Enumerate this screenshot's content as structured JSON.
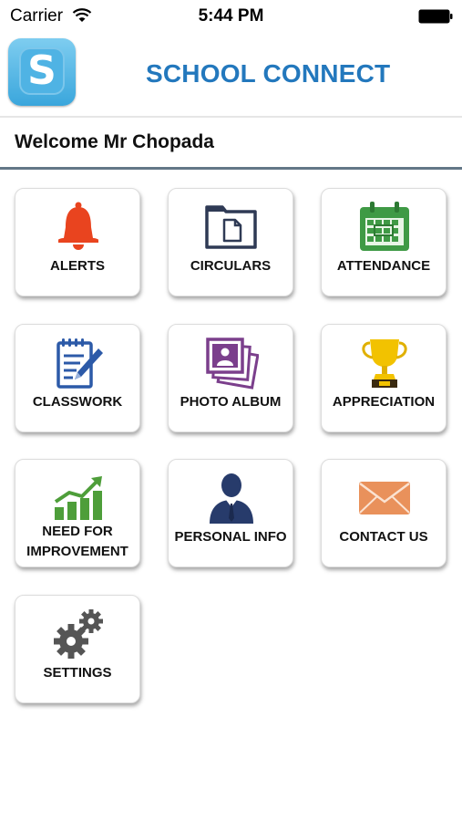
{
  "status_bar": {
    "carrier": "Carrier",
    "time": "5:44 PM"
  },
  "header": {
    "logo_letter": "S",
    "title": "SCHOOL CONNECT"
  },
  "welcome": {
    "text": "Welcome Mr Chopada"
  },
  "menu": {
    "alerts": {
      "label": "ALERTS",
      "icon": "bell-icon"
    },
    "circulars": {
      "label": "CIRCULARS",
      "icon": "folder-document-icon"
    },
    "attendance": {
      "label": "ATTENDANCE",
      "icon": "calendar-icon"
    },
    "classwork": {
      "label": "CLASSWORK",
      "icon": "notepad-pencil-icon"
    },
    "photo_album": {
      "label": "PHOTO ALBUM",
      "icon": "photo-stack-icon"
    },
    "appreciation": {
      "label": "APPRECIATION",
      "icon": "trophy-icon"
    },
    "need_for_improvement": {
      "label_line1": "NEED FOR",
      "label_line2": "IMPROVEMENT",
      "icon": "growth-chart-icon"
    },
    "personal_info": {
      "label": "PERSONAL INFO",
      "icon": "person-icon"
    },
    "contact_us": {
      "label": "CONTACT US",
      "icon": "envelope-icon"
    },
    "settings": {
      "label": "SETTINGS",
      "icon": "gears-icon"
    }
  },
  "colors": {
    "title_blue": "#2378bd",
    "alert_red": "#e9441f",
    "circular_navy": "#2f3a55",
    "attendance_green": "#3f9a45",
    "classwork_blue": "#2c5aa8",
    "photo_purple": "#7b3f8c",
    "trophy_gold": "#f2c200",
    "chart_green": "#4e9e3a",
    "person_navy": "#273b6b",
    "envelope_orange": "#e9915b",
    "gear_gray": "#555555",
    "divider": "#637787"
  }
}
